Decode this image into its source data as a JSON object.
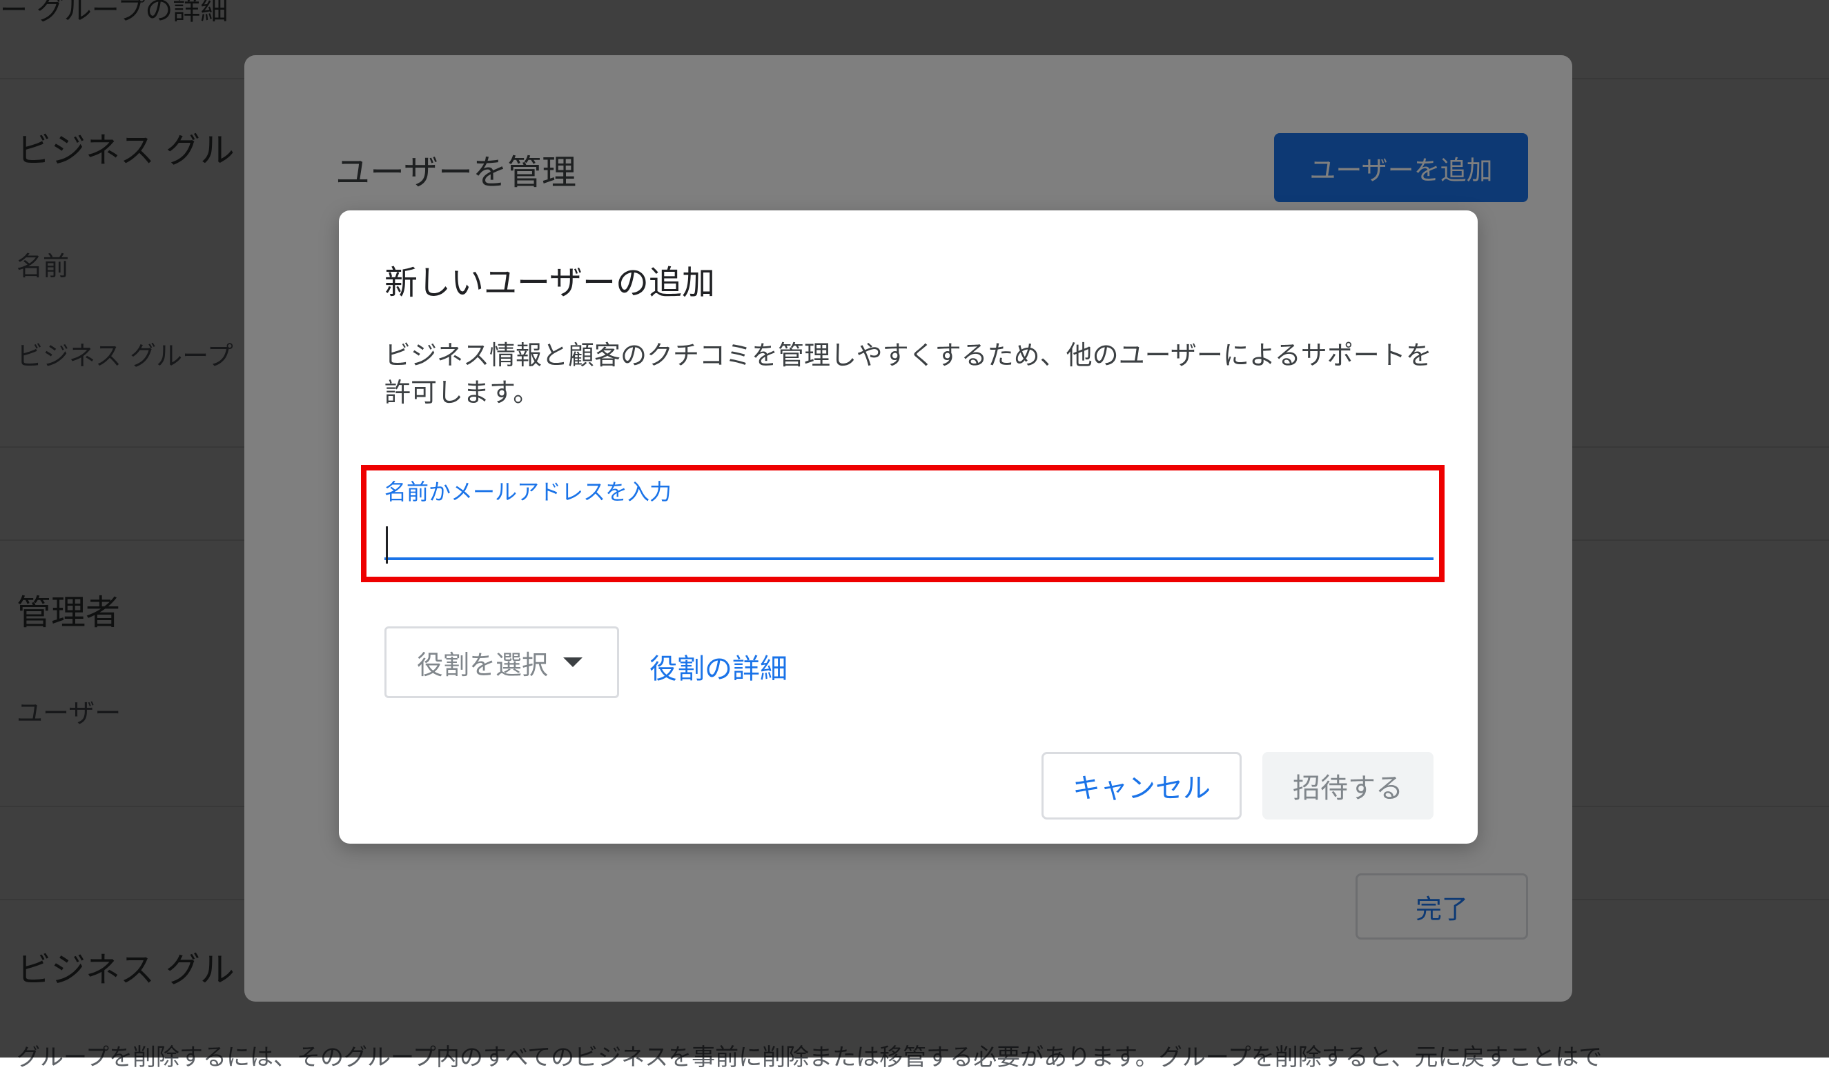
{
  "background_page": {
    "title": "ー グループの詳細",
    "section_heading_1": "ビジネス グル",
    "label_name": "名前",
    "label_business_group": "ビジネス グループ",
    "section_heading_admins": "管理者",
    "label_users": "ユーザー",
    "section_heading_2": "ビジネス グル",
    "footer_text": "グループを削除するには、そのグループ内のすべてのビジネスを事前に削除または移管する必要があります。グループを削除すると、元に戻すことはで"
  },
  "manage_users_dialog": {
    "title": "ユーザーを管理",
    "add_user_button": "ユーザーを追加",
    "done_button": "完了"
  },
  "add_user_dialog": {
    "title": "新しいユーザーの追加",
    "description": "ビジネス情報と顧客のクチコミを管理しやすくするため、他のユーザーによるサポートを許可します。",
    "input_label": "名前かメールアドレスを入力",
    "input_value": "",
    "role_select_label": "役割を選択",
    "role_details_link": "役割の詳細",
    "cancel_button": "キャンセル",
    "invite_button": "招待する"
  },
  "colors": {
    "primary": "#1a73e8",
    "highlight": "#ee0000",
    "disabled_text": "#80868b"
  }
}
